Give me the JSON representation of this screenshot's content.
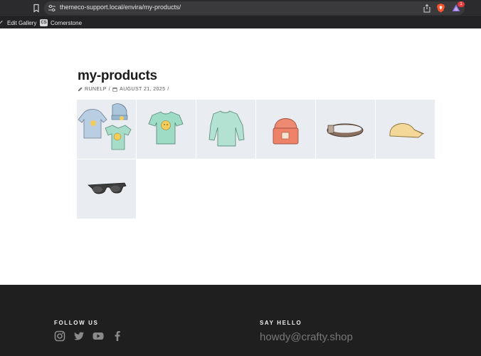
{
  "browser": {
    "url": "themeco-support.local/envira/my-products/",
    "rewards_count": "1",
    "bookmarks": [
      {
        "label": "Edit Gallery"
      },
      {
        "label": "Cornerstone"
      }
    ]
  },
  "post": {
    "title": "my-products",
    "author": "RUNELP",
    "date": "AUGUST 21, 2025",
    "separator": "/"
  },
  "gallery": {
    "items": [
      {
        "name": "hoodie-beanie-tee set"
      },
      {
        "name": "t-shirt"
      },
      {
        "name": "long sleeve shirt"
      },
      {
        "name": "beanie"
      },
      {
        "name": "belt"
      },
      {
        "name": "cap"
      },
      {
        "name": "sunglasses"
      }
    ]
  },
  "footer": {
    "follow_heading": "FOLLOW US",
    "say_hello_heading": "SAY HELLO",
    "email": "howdy@crafty.shop",
    "social": [
      "instagram",
      "twitter",
      "youtube",
      "facebook"
    ]
  },
  "colors": {
    "tile_bg": "#e9edf2",
    "footer_bg": "#1f1f1f",
    "chrome_bg": "#2b2b2e"
  }
}
